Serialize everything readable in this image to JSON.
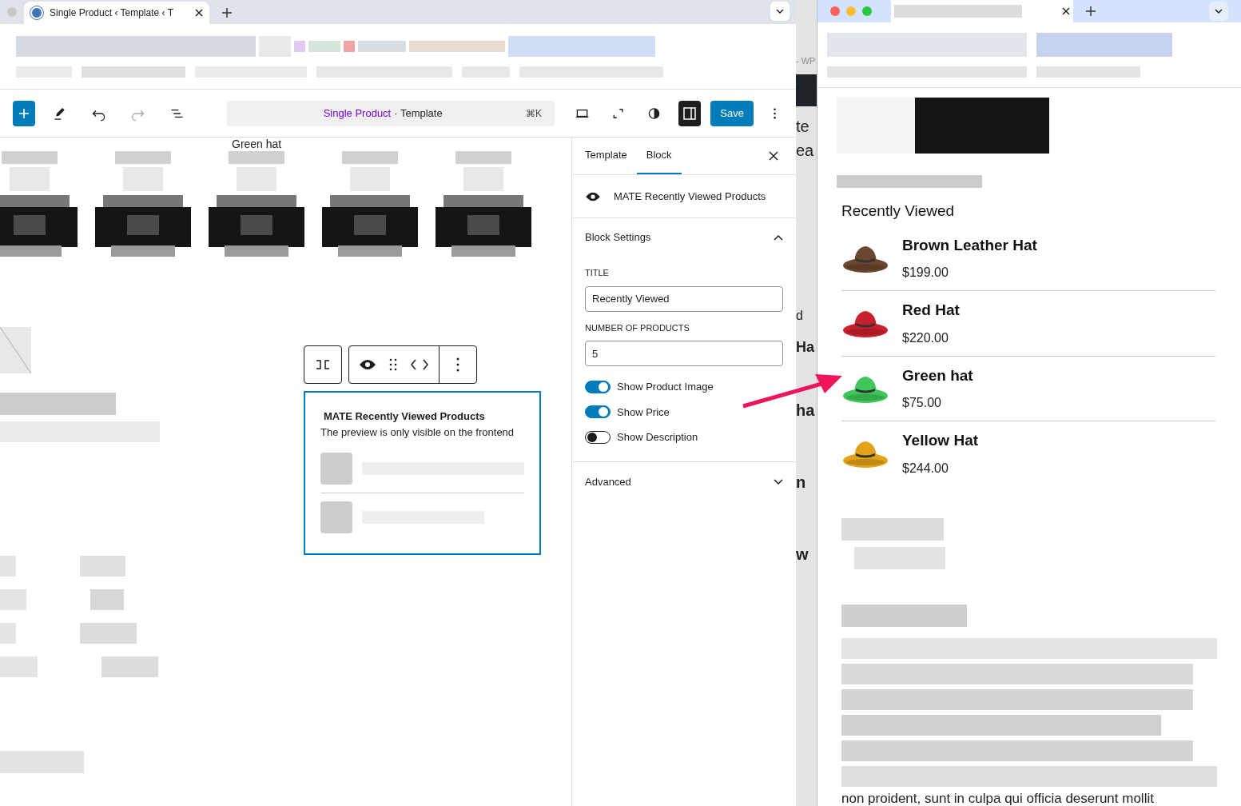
{
  "browser_tab": {
    "title": "Single Product ‹ Template ‹ T"
  },
  "toolbar": {
    "command_link": "Single Product",
    "command_rest": "· Template",
    "shortcut": "⌘K",
    "save": "Save"
  },
  "canvas": {
    "cut_heading": "Green hat",
    "block": {
      "title": "MATE Recently Viewed Products",
      "note": "The preview is only visible on the frontend"
    }
  },
  "sidebar": {
    "tabs": [
      {
        "label": "Template",
        "selected": false
      },
      {
        "label": "Block",
        "selected": true
      }
    ],
    "block_name": "MATE Recently Viewed Products",
    "settings": {
      "title": "Block Settings",
      "expanded": true
    },
    "fields": [
      {
        "label": "TITLE",
        "value": "Recently Viewed"
      },
      {
        "label": "NUMBER OF PRODUCTS",
        "value": "5"
      }
    ],
    "toggles": [
      {
        "label": "Show Product Image",
        "on": true
      },
      {
        "label": "Show Price",
        "on": true
      },
      {
        "label": "Show Description",
        "on": false
      }
    ],
    "advanced": {
      "title": "Advanced",
      "expanded": false
    }
  },
  "background_fragments": [
    "- WP",
    "te",
    "ea",
    "d",
    "Ha",
    "ha",
    "n",
    "w"
  ],
  "frontend": {
    "heading": "Recently Viewed",
    "products": [
      {
        "name": "Brown Leather Hat",
        "price": "$199.00"
      },
      {
        "name": "Red Hat",
        "price": "$220.00"
      },
      {
        "name": "Green hat",
        "price": "$75.00"
      },
      {
        "name": "Yellow Hat",
        "price": "$244.00"
      }
    ],
    "cut_text": "non proident, sunt in culpa qui officia deserunt mollit"
  }
}
